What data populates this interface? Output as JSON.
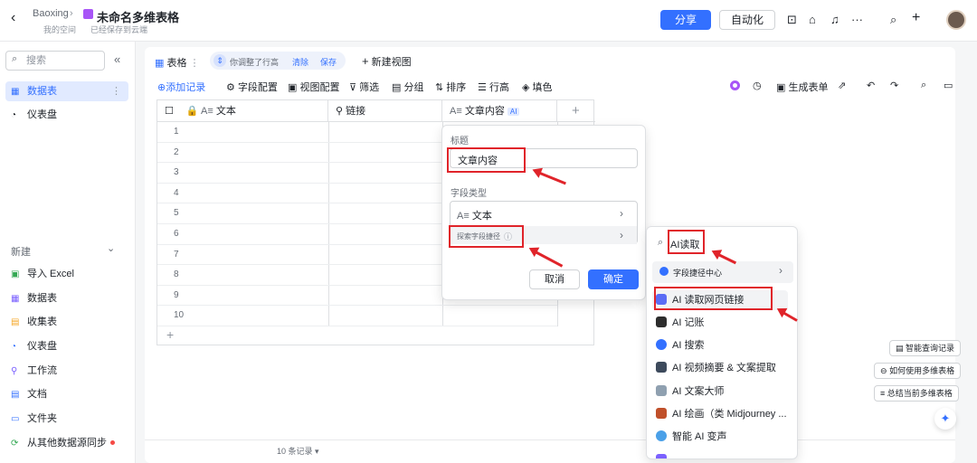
{
  "topbar": {
    "back_icon": "chevron-left-icon",
    "breadcrumb_parent": "Baoxing",
    "title": "未命名多维表格",
    "location": "我的空间",
    "save_status": "已经保存到云端",
    "share_label": "分享",
    "automation_label": "自动化",
    "icons": [
      "robot-icon",
      "plugin-icon",
      "bell-icon",
      "more-icon",
      "search-icon",
      "plus-icon"
    ]
  },
  "sidebar": {
    "search_placeholder": "搜索",
    "collapse_glyph": "«",
    "items": [
      {
        "label": "数据表",
        "icon": "table-icon"
      },
      {
        "label": "仪表盘",
        "icon": "dashboard-icon"
      }
    ],
    "new_section_label": "新建",
    "new_items": [
      {
        "label": "导入 Excel",
        "icon": "excel-icon"
      },
      {
        "label": "数据表",
        "icon": "table-icon"
      },
      {
        "label": "收集表",
        "icon": "form-icon"
      },
      {
        "label": "仪表盘",
        "icon": "dashboard-icon"
      },
      {
        "label": "工作流",
        "icon": "workflow-icon"
      },
      {
        "label": "文档",
        "icon": "doc-icon"
      },
      {
        "label": "文件夹",
        "icon": "folder-icon"
      },
      {
        "label": "从其他数据源同步",
        "icon": "sync-icon"
      }
    ]
  },
  "tabs": {
    "table_tab": "表格",
    "row_height_tip": "你调整了行高",
    "clear": "清除",
    "save": "保存",
    "new_view": "新建视图"
  },
  "toolbar": {
    "add_record": "添加记录",
    "field_config": "字段配置",
    "view_config": "视图配置",
    "filter": "筛选",
    "group": "分组",
    "sort": "排序",
    "row_height": "行高",
    "fill": "填色",
    "gen_form": "生成表单"
  },
  "grid": {
    "columns": [
      "文本",
      "链接",
      "文章内容"
    ],
    "ai_badge": "AI",
    "rows": [
      "1",
      "2",
      "3",
      "4",
      "5",
      "6",
      "7",
      "8",
      "9",
      "10"
    ],
    "footer": "10 条记录"
  },
  "field_popup": {
    "title_label": "标题",
    "title_value": "文章内容",
    "type_label": "字段类型",
    "type_value": "文本",
    "explore_label": "探索字段捷径",
    "cancel": "取消",
    "confirm": "确定"
  },
  "shortcut_popup": {
    "search_value": "AI读取",
    "center_label": "字段捷径中心",
    "items": [
      {
        "label": "AI 读取网页链接",
        "color": "#5b6cf5"
      },
      {
        "label": "AI 记账",
        "color": "#2d2d2d"
      },
      {
        "label": "AI 搜索",
        "color": "#3370ff"
      },
      {
        "label": "AI 视频摘要 & 文案提取",
        "color": "#3d4a5c"
      },
      {
        "label": "AI 文案大师",
        "color": "#8fa0b0"
      },
      {
        "label": "AI 绘画（类 Midjourney ...",
        "color": "#c0502a"
      },
      {
        "label": "智能 AI 变声",
        "color": "#4aa0e8"
      }
    ]
  },
  "right_panel": {
    "btn1": "智能查询记录",
    "btn2": "如何使用多维表格",
    "btn3": "总结当前多维表格"
  }
}
